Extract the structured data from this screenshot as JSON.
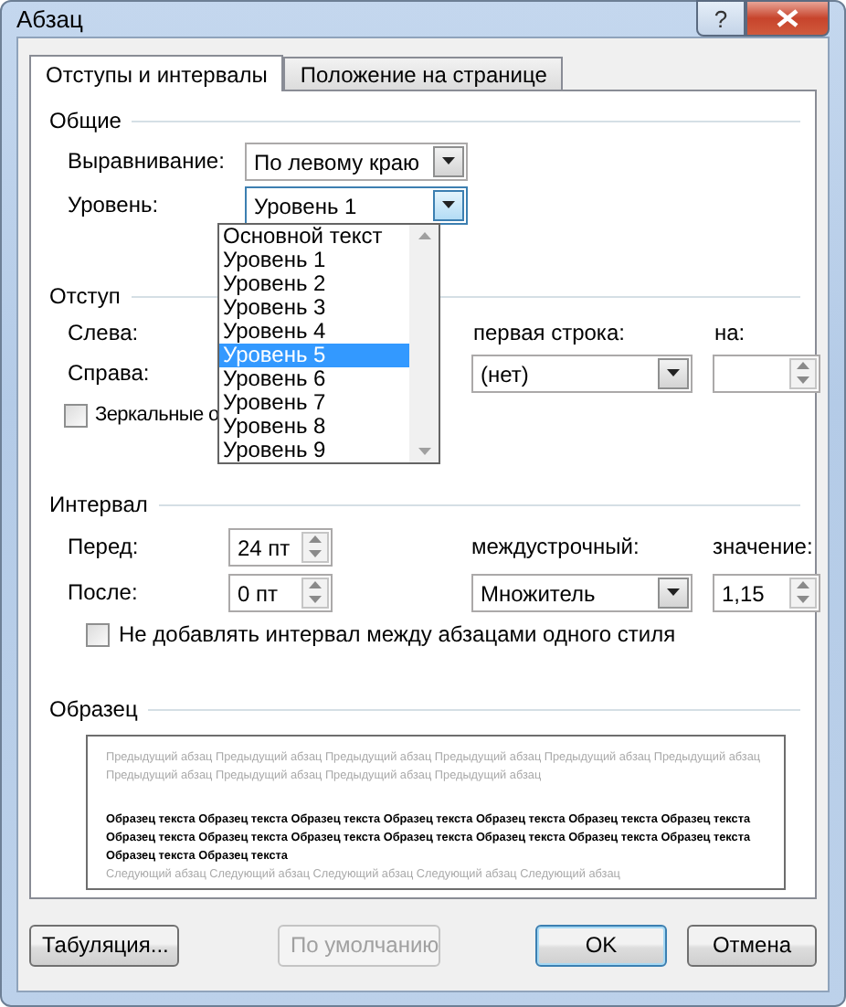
{
  "window": {
    "title": "Абзац",
    "help": "?"
  },
  "tabs": [
    {
      "label": "Отступы и интервалы",
      "selected": true
    },
    {
      "label": "Положение на странице",
      "selected": false
    }
  ],
  "general": {
    "heading": "Общие",
    "alignment": {
      "label": "Выравнивание:",
      "value": "По левому краю"
    },
    "level": {
      "label": "Уровень:",
      "value": "Уровень 1",
      "expanded": true
    }
  },
  "level_options": [
    {
      "label": "Основной текст",
      "selected": false
    },
    {
      "label": "Уровень 1",
      "selected": false
    },
    {
      "label": "Уровень 2",
      "selected": false
    },
    {
      "label": "Уровень 3",
      "selected": false
    },
    {
      "label": "Уровень 4",
      "selected": false
    },
    {
      "label": "Уровень 5",
      "selected": true
    },
    {
      "label": "Уровень 6",
      "selected": false
    },
    {
      "label": "Уровень 7",
      "selected": false
    },
    {
      "label": "Уровень 8",
      "selected": false
    },
    {
      "label": "Уровень 9",
      "selected": false
    }
  ],
  "indent": {
    "heading": "Отступ",
    "left_label": "Слева:",
    "right_label": "Справа:",
    "first_line": {
      "label": "первая строка:",
      "value": "(нет)"
    },
    "by": {
      "label": "на:"
    },
    "mirror": {
      "label": "Зеркальные о",
      "checked": false
    }
  },
  "spacing": {
    "heading": "Интервал",
    "before": {
      "label": "Перед:",
      "value": "24 пт"
    },
    "after": {
      "label": "После:",
      "value": "0 пт"
    },
    "line_spacing": {
      "label": "междустрочный:",
      "value": "Множитель"
    },
    "at": {
      "label": "значение:",
      "value": "1,15"
    },
    "no_space": {
      "label": "Не добавлять интервал между абзацами одного стиля",
      "checked": false
    }
  },
  "preview": {
    "heading": "Образец",
    "previous": "Предыдущий абзац Предыдущий абзац Предыдущий абзац Предыдущий абзац Предыдущий абзац Предыдущий абзац Предыдущий абзац Предыдущий абзац Предыдущий абзац Предыдущий абзац",
    "sample": "Образец текста Образец текста Образец текста Образец текста Образец текста Образец текста Образец текста Образец текста Образец текста Образец текста Образец текста Образец текста Образец текста Образец текста Образец текста Образец текста",
    "next": "Следующий абзац Следующий абзац Следующий абзац Следующий абзац Следующий абзац"
  },
  "buttons": [
    {
      "label": "Табуляция...",
      "disabled": false,
      "default": false
    },
    {
      "label": "По умолчанию",
      "disabled": true,
      "default": false
    },
    {
      "label": "OK",
      "disabled": false,
      "default": true
    },
    {
      "label": "Отмена",
      "disabled": false,
      "default": false
    }
  ]
}
